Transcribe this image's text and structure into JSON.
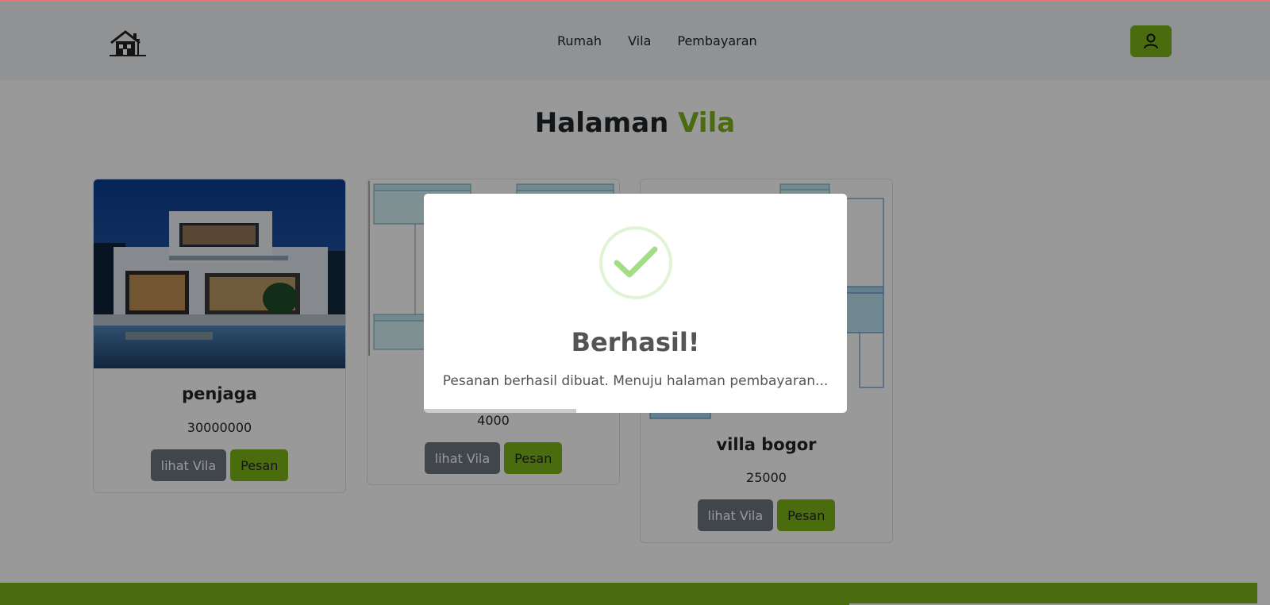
{
  "colors": {
    "accent": "#7cb518",
    "success": "#a5dc86",
    "overlay": "rgba(0,0,0,0.4)"
  },
  "navbar": {
    "logo_icon": "house-icon",
    "links": [
      "Rumah",
      "Vila",
      "Pembayaran"
    ],
    "user_icon": "user-icon"
  },
  "page": {
    "title_prefix": "Halaman",
    "title_highlight": "Vila"
  },
  "cards": [
    {
      "title": "penjaga",
      "price": "30000000",
      "view_label": "lihat Vila",
      "order_label": "Pesan",
      "image": "photo-modern-villa"
    },
    {
      "title": "",
      "price": "4000",
      "view_label": "lihat Vila",
      "order_label": "Pesan",
      "image": "diagram-screenshot"
    },
    {
      "title": "villa bogor",
      "price": "25000",
      "view_label": "lihat Vila",
      "order_label": "Pesan",
      "image": "diagram-screenshot"
    }
  ],
  "modal": {
    "icon": "check-circle-icon",
    "title": "Berhasil!",
    "text": "Pesanan berhasil dibuat. Menuju halaman pembayaran...",
    "timer_progress": 0.36
  }
}
